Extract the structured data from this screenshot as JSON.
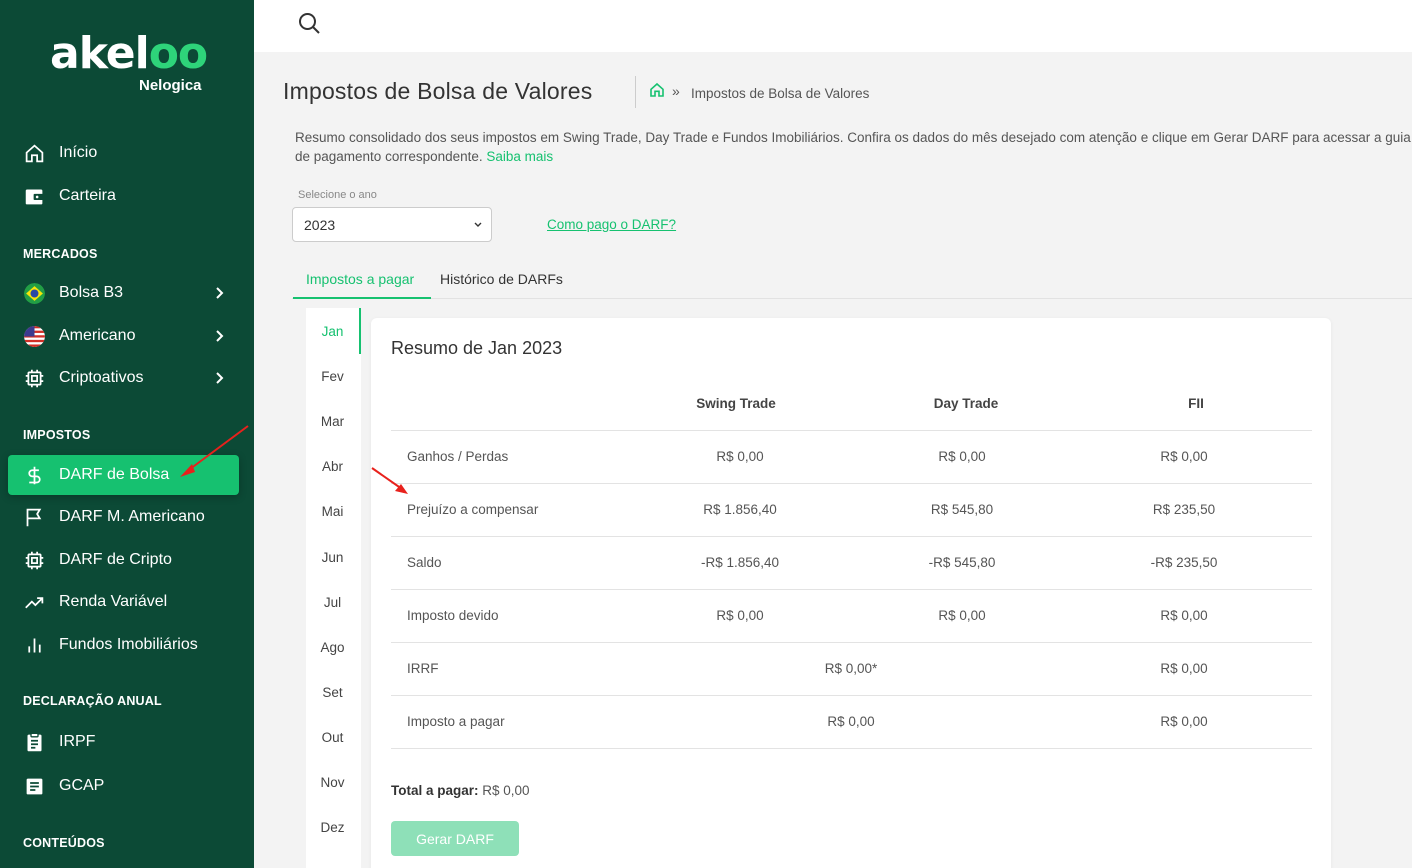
{
  "brand": {
    "logo_prefix": "akel",
    "logo_oo": "oo",
    "sub": "Nelogica"
  },
  "sidebar": {
    "items": [
      {
        "label": "Início"
      },
      {
        "label": "Carteira"
      }
    ],
    "sections": {
      "mercados": "MERCADOS",
      "impostos": "IMPOSTOS",
      "declaracao": "DECLARAÇÃO ANUAL",
      "conteudos": "CONTEÚDOS"
    },
    "markets": [
      {
        "label": "Bolsa B3"
      },
      {
        "label": "Americano"
      },
      {
        "label": "Criptoativos"
      }
    ],
    "taxes": [
      {
        "label": "DARF de Bolsa"
      },
      {
        "label": "DARF M. Americano"
      },
      {
        "label": "DARF de Cripto"
      },
      {
        "label": "Renda Variável"
      },
      {
        "label": "Fundos Imobiliários"
      }
    ],
    "annual": [
      {
        "label": "IRPF"
      },
      {
        "label": "GCAP"
      }
    ]
  },
  "header": {
    "title": "Impostos de Bolsa de Valores",
    "breadcrumb_sep": "»",
    "breadcrumb_current": "Impostos de Bolsa de Valores"
  },
  "intro": {
    "text": "Resumo consolidado dos seus impostos em Swing Trade, Day Trade e Fundos Imobiliários. Confira os dados do mês desejado com atenção e clique em Gerar DARF para acessar a guia de pagamento correspondente. ",
    "link": "Saiba mais"
  },
  "year_select": {
    "label": "Selecione o ano",
    "value": "2023"
  },
  "how_pay_link": "Como pago o DARF?",
  "tabs": [
    "Impostos a pagar",
    "Histórico de DARFs"
  ],
  "months": [
    "Jan",
    "Fev",
    "Mar",
    "Abr",
    "Mai",
    "Jun",
    "Jul",
    "Ago",
    "Set",
    "Out",
    "Nov",
    "Dez"
  ],
  "summary": {
    "title": "Resumo de Jan 2023",
    "columns": [
      "Swing Trade",
      "Day Trade",
      "FII"
    ],
    "rows": [
      {
        "label": "Ganhos / Perdas",
        "values": [
          "R$ 0,00",
          "R$ 0,00",
          "R$ 0,00"
        ]
      },
      {
        "label": "Prejuízo a compensar",
        "values": [
          "R$ 1.856,40",
          "R$ 545,80",
          "R$ 235,50"
        ]
      },
      {
        "label": "Saldo",
        "values": [
          "-R$ 1.856,40",
          "-R$ 545,80",
          "-R$ 235,50"
        ]
      },
      {
        "label": "Imposto devido",
        "values": [
          "R$ 0,00",
          "R$ 0,00",
          "R$ 0,00"
        ]
      },
      {
        "label": "IRRF",
        "merged": "R$ 0,00*",
        "fii": "R$ 0,00"
      },
      {
        "label": "Imposto a pagar",
        "merged": "R$ 0,00",
        "fii": "R$ 0,00"
      }
    ],
    "total_label": "Total a pagar:",
    "total_value": " R$ 0,00",
    "button": "Gerar DARF"
  },
  "colors": {
    "sidebar": "#0c4a36",
    "accent": "#16c170",
    "button_disabled": "#8ee0b8",
    "annotation": "#e8211c"
  }
}
